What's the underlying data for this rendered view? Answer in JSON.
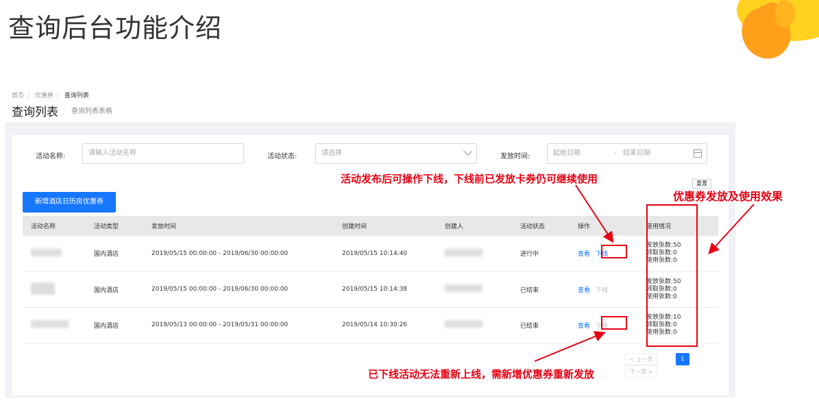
{
  "slide": {
    "title": "查询后台功能介绍"
  },
  "breadcrumb": [
    "首页",
    "优惠券",
    "查询列表"
  ],
  "page": {
    "title": "查询列表",
    "subtitle": "查询列表表格"
  },
  "filters": {
    "name_label": "活动名称:",
    "name_placeholder": "请输入活动名称",
    "status_label": "活动状态:",
    "status_placeholder": "请选择",
    "time_label": "发放时间:",
    "start_placeholder": "起始日期",
    "range_sep": "-",
    "end_placeholder": "结束日期",
    "reset_label": "重置"
  },
  "add_button": "新增酒店日历房优惠券",
  "table": {
    "columns": [
      "活动名称",
      "活动类型",
      "发放时间",
      "创建时间",
      "创建人",
      "活动状态",
      "操作",
      "使用情况"
    ],
    "view_label": "查看",
    "offline_label": "下线",
    "rows": [
      {
        "type": "国内酒店",
        "period": "2019/05/15 00:00:00 - 2019/06/30 00:00:00",
        "created": "2019/05/15 10:14:40",
        "status": "进行中",
        "offline_enabled": true,
        "usage": [
          "发放张数:50",
          "领取张数:0",
          "使用张数:0"
        ]
      },
      {
        "type": "国内酒店",
        "period": "2019/05/15 00:00:00 - 2019/06/30 00:00:00",
        "created": "2019/05/15 10:14:38",
        "status": "已结束",
        "offline_enabled": false,
        "usage": [
          "发放张数:50",
          "领取张数:0",
          "使用张数:0"
        ]
      },
      {
        "type": "国内酒店",
        "period": "2019/05/13 00:00:00 - 2019/05/31 00:00:00",
        "created": "2019/05/14 10:30:26",
        "status": "已结束",
        "offline_enabled": false,
        "usage": [
          "发放张数:10",
          "领取张数:0",
          "使用张数:0"
        ]
      }
    ]
  },
  "pagination": {
    "prev": "< 上一页",
    "current": "1",
    "next": "下一页 >"
  },
  "annotations": {
    "offline_note": "活动发布后可操作下线，下线前已发放卡券仍可继续使用",
    "usage_note": "优惠券发放及使用效果",
    "relaunch_note": "已下线活动无法重新上线，需新增优惠券重新发放"
  },
  "colors": {
    "primary": "#1677ff",
    "annotation": "#e60012"
  }
}
